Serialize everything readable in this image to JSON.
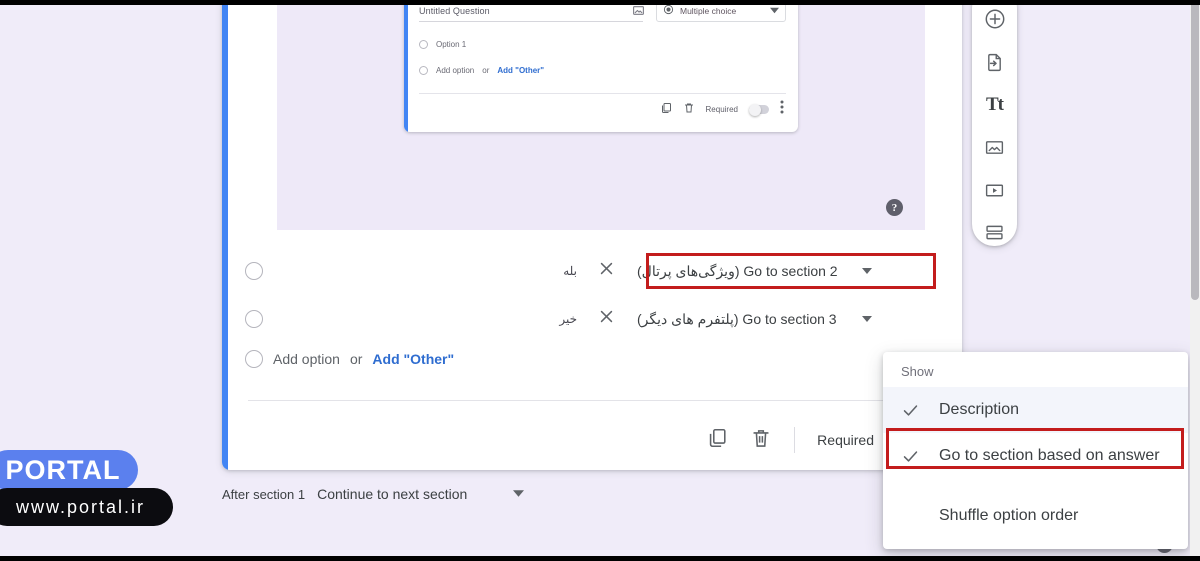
{
  "app": {
    "page_background": "#f0ecf9",
    "accent_color": "#4285f4",
    "highlight_outline_color": "#c31c1c",
    "link_color": "#2f6dd0"
  },
  "nested_preview": {
    "question_title_placeholder": "Untitled Question",
    "question_type": "Multiple choice",
    "option_1": "Option 1",
    "add_option": "Add option",
    "or": "or",
    "add_other": "Add \"Other\"",
    "required_label": "Required",
    "image_icon": "image-icon",
    "radio_icon": "radio-icon",
    "dropdown_arrow": "chevron-down-icon",
    "duplicate_icon": "duplicate-icon",
    "delete_icon": "trash-icon",
    "more_icon": "more-vert-icon",
    "help_icon": "help-icon"
  },
  "question": {
    "options": [
      {
        "text": "بله",
        "remove_icon": "close-icon",
        "goto_label": "(ویژگی‌های پرتال) Go to section 2",
        "goto_arrow": "chevron-down-icon",
        "highlighted": true
      },
      {
        "text": "خیر",
        "remove_icon": "close-icon",
        "goto_label": "(پلتفرم های دیگر) Go to section 3",
        "goto_arrow": "chevron-down-icon",
        "highlighted": false
      }
    ],
    "add_option": "Add option",
    "or": "or",
    "add_other": "Add \"Other\"",
    "footer": {
      "duplicate_icon": "duplicate-icon",
      "delete_icon": "trash-icon",
      "required_label": "Required",
      "required_on": false
    }
  },
  "after_section": {
    "label": "After section 1",
    "selected": "Continue to next section",
    "arrow": "chevron-down-icon"
  },
  "float_toolbar": {
    "items": [
      {
        "name": "add-question-button",
        "icon": "plus-circle-icon"
      },
      {
        "name": "import-questions-button",
        "icon": "import-file-icon"
      },
      {
        "name": "add-title-button",
        "icon": "text-title-icon",
        "glyph": "Tt"
      },
      {
        "name": "add-image-button",
        "icon": "image-icon"
      },
      {
        "name": "add-video-button",
        "icon": "video-icon"
      },
      {
        "name": "add-section-button",
        "icon": "add-section-icon"
      }
    ]
  },
  "menu": {
    "header": "Show",
    "items": [
      {
        "label": "Description",
        "checked": true,
        "highlighted": true,
        "outlined": false
      },
      {
        "label": "Go to section based on answer",
        "checked": true,
        "highlighted": false,
        "outlined": true
      },
      {
        "label": "Shuffle option order",
        "checked": false,
        "highlighted": false,
        "outlined": false
      }
    ]
  },
  "help": {
    "glyph": "?",
    "icon": "help-icon"
  },
  "watermark": {
    "brand": "PORTAL",
    "url": "www.portal.ir",
    "brand_bg": "#5b80ee",
    "url_bg": "#0c0c10"
  }
}
